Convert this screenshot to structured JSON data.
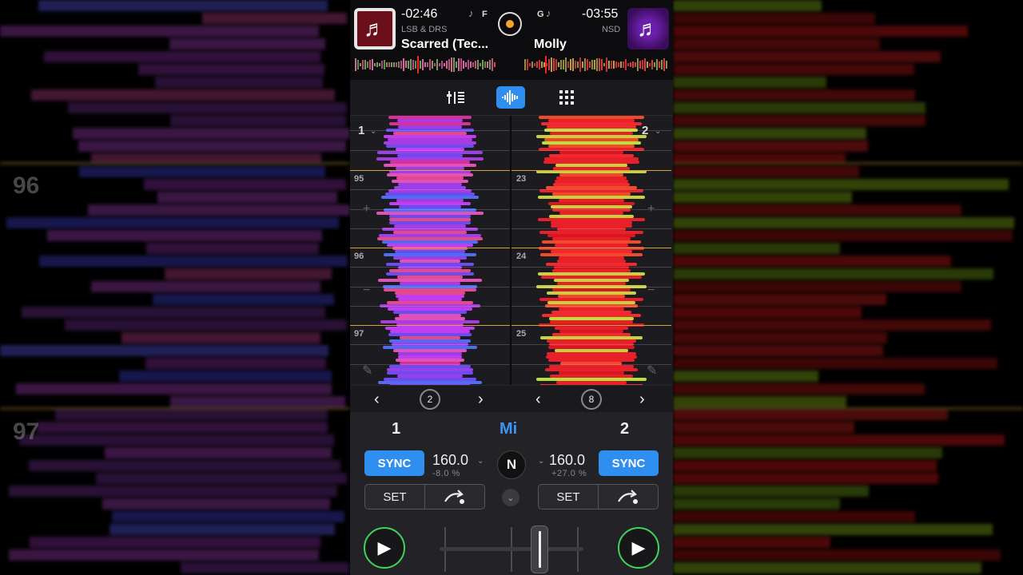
{
  "deck1": {
    "time_remaining": "-02:46",
    "artist": "LSB & DRS",
    "title": "Scarred (Tec...",
    "key": "F",
    "deck_number": "1",
    "bpm": "160.0",
    "pitch": "-8.0 %",
    "sync_label": "SYNC",
    "set_label": "SET",
    "loop_size": "2",
    "bar_numbers": [
      "95",
      "96",
      "97"
    ]
  },
  "deck2": {
    "time_remaining": "-03:55",
    "artist": "NSD",
    "title": "Molly",
    "key": "G",
    "deck_number": "2",
    "bpm": "160.0",
    "pitch": "+27.0 %",
    "sync_label": "SYNC",
    "set_label": "SET",
    "loop_size": "8",
    "bar_numbers": [
      "23",
      "24",
      "25"
    ]
  },
  "mixer": {
    "tab_deck1": "1",
    "tab_mix": "Mi",
    "tab_deck2": "2",
    "logo_letter": "N"
  },
  "background": {
    "label_96": "96",
    "label_97": "97"
  },
  "icons": {
    "music_note": "music-note-icon",
    "mixer_view": "mixer-view-icon",
    "waveform_view": "waveform-view-icon",
    "pads_view": "pads-grid-icon",
    "play": "play-icon",
    "cue_jump": "cue-jump-icon",
    "loop": "loop-icon"
  },
  "colors": {
    "accent_blue": "#2f8ff0",
    "play_green": "#3cd55a",
    "deck1_wave": "#c23cf0",
    "deck2_wave": "#e8202a",
    "beat_marker": "#d7a23b"
  }
}
